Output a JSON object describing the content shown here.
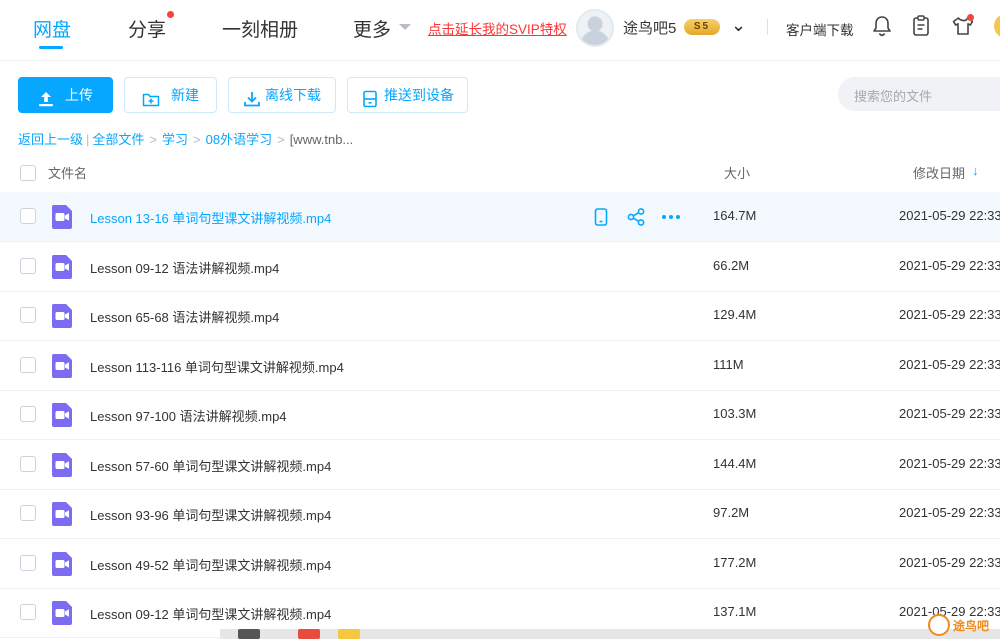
{
  "topnav": {
    "tabs": [
      {
        "label": "网盘",
        "active": true
      },
      {
        "label": "分享",
        "badge_dot": true
      },
      {
        "label": "一刻相册"
      },
      {
        "label": "更多"
      }
    ],
    "svip_promo": "点击延长我的SVIP特权",
    "username": "途鸟吧5",
    "vip_level": "5",
    "client_download": "客户端下载",
    "icons": [
      "bell-icon",
      "clipboard-icon",
      "tshirt-icon"
    ]
  },
  "toolbar": {
    "upload": "上传",
    "new": "新建",
    "offline_download": "离线下载",
    "push_to_device": "推送到设备",
    "search_placeholder": "搜索您的文件"
  },
  "breadcrumb": {
    "back": "返回上一级",
    "all_files": "全部文件",
    "path": [
      "学习",
      "08外语学习"
    ],
    "current": "[www.tnb..."
  },
  "table": {
    "columns": {
      "name": "文件名",
      "size": "大小",
      "modified": "修改日期"
    },
    "sort": {
      "column": "modified",
      "direction": "desc"
    },
    "rows": [
      {
        "name": "Lesson 13-16 单词句型课文讲解视频.mp4",
        "size": "164.7M",
        "date": "2021-05-29 22:33"
      },
      {
        "name": "Lesson 09-12 语法讲解视频.mp4",
        "size": "66.2M",
        "date": "2021-05-29 22:33"
      },
      {
        "name": "Lesson 65-68 语法讲解视频.mp4",
        "size": "129.4M",
        "date": "2021-05-29 22:33"
      },
      {
        "name": "Lesson 113-116 单词句型课文讲解视频.mp4",
        "size": "111M",
        "date": "2021-05-29 22:33"
      },
      {
        "name": "Lesson 97-100 语法讲解视频.mp4",
        "size": "103.3M",
        "date": "2021-05-29 22:33"
      },
      {
        "name": "Lesson 57-60 单词句型课文讲解视频.mp4",
        "size": "144.4M",
        "date": "2021-05-29 22:33"
      },
      {
        "name": "Lesson 93-96 单词句型课文讲解视频.mp4",
        "size": "97.2M",
        "date": "2021-05-29 22:33"
      },
      {
        "name": "Lesson 49-52 单词句型课文讲解视频.mp4",
        "size": "177.2M",
        "date": "2021-05-29 22:33"
      },
      {
        "name": "Lesson 09-12 单词句型课文讲解视频.mp4",
        "size": "137.1M",
        "date": "2021-05-29 22:33"
      }
    ],
    "row_actions": [
      "phone-icon",
      "share-icon",
      "more-icon"
    ]
  },
  "watermark": {
    "text": "途鸟吧"
  },
  "colors": {
    "accent": "#06a7ff",
    "promo": "#ff3333",
    "video_icon": "#7c6cf2",
    "hover_row": "#f3f9ff"
  }
}
